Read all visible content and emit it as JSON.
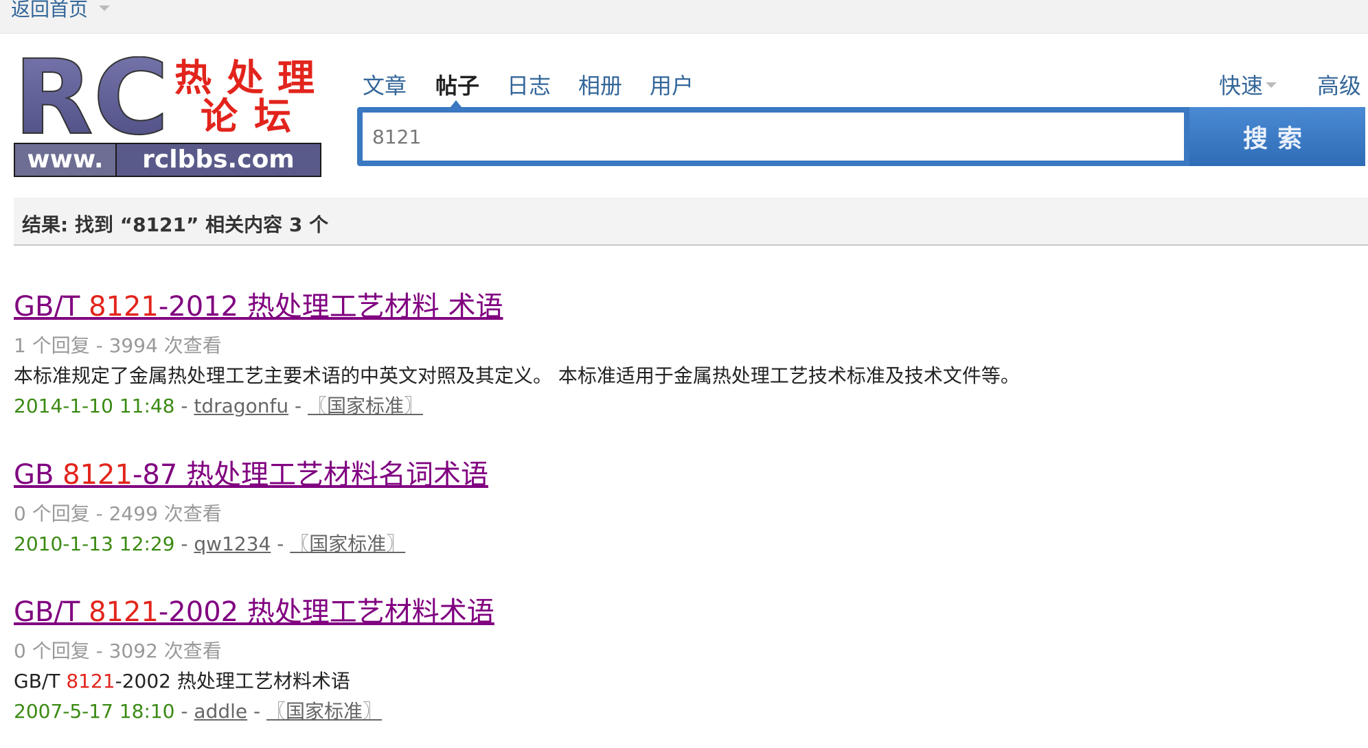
{
  "topbar": {
    "home_label": "返回首页"
  },
  "logo": {
    "rc_text": "RC",
    "cn_chars": [
      "热",
      "处",
      "理",
      "论",
      "坛"
    ],
    "url_www": "www.",
    "url_domain": "rclbbs.com"
  },
  "search": {
    "tabs": [
      "文章",
      "帖子",
      "日志",
      "相册",
      "用户"
    ],
    "active_tab": "帖子",
    "quick_label": "快速",
    "advanced_label": "高级",
    "query": "8121",
    "button_label": "搜索"
  },
  "results_summary": "结果: 找到 “8121” 相关内容 3 个",
  "results": [
    {
      "title_prefix": "GB/T ",
      "title_highlight": "8121",
      "title_suffix": "-2012 热处理工艺材料 术语",
      "meta": "1 个回复 - 3994 次查看",
      "desc_prefix": "",
      "desc_highlight": "",
      "desc_suffix": "本标准规定了金属热处理工艺主要术语的中英文对照及其定义。 本标准适用于金属热处理工艺技术标准及技术文件等。",
      "date": "2014-1-10 11:48",
      "author": "tdragonfu",
      "forum": "〖国家标准〗"
    },
    {
      "title_prefix": "GB ",
      "title_highlight": "8121",
      "title_suffix": "-87 热处理工艺材料名词术语",
      "meta": "0 个回复 - 2499 次查看",
      "date": "2010-1-13 12:29",
      "author": "qw1234",
      "forum": "〖国家标准〗"
    },
    {
      "title_prefix": "GB/T ",
      "title_highlight": "8121",
      "title_suffix": "-2002 热处理工艺材料术语",
      "meta": "0 个回复 - 3092 次查看",
      "desc_prefix": "GB/T ",
      "desc_highlight": "8121",
      "desc_suffix": "-2002 热处理工艺材料术语",
      "date": "2007-5-17 18:10",
      "author": "addle",
      "forum": "〖国家标准〗"
    }
  ],
  "separator": " - ",
  "colors": {
    "link_visited": "#800080",
    "highlight": "#e2241c",
    "date": "#3a8a13",
    "accent": "#3a78c2"
  }
}
